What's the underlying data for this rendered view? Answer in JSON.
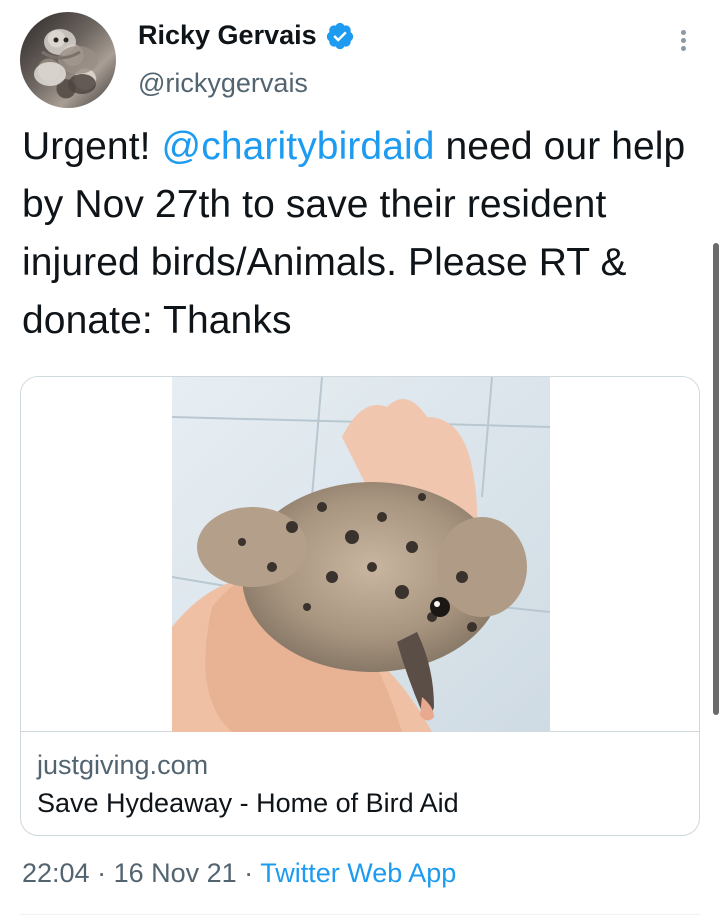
{
  "author": {
    "display_name": "Ricky Gervais",
    "handle": "@rickygervais",
    "verified": true,
    "avatar_icon": "avatar-photo-cats"
  },
  "tweet": {
    "text_before_mention": "Urgent! ",
    "mention": "@charitybirdaid",
    "text_after_mention": " need our help by Nov 27th to save their resident injured birds/Animals. Please RT & donate: Thanks"
  },
  "card": {
    "domain": "justgiving.com",
    "title": "Save Hydeaway - Home of Bird Aid",
    "image_icon": "bird-chick-photo"
  },
  "meta": {
    "time": "22:04",
    "separator": " · ",
    "date": "16 Nov 21",
    "source": "Twitter Web App"
  },
  "colors": {
    "accent": "#1d9bf0",
    "text": "#0f1419",
    "secondary": "#536471",
    "border": "#cfd9de"
  },
  "icons": {
    "verified": "verified-badge-icon",
    "more": "more-options-icon"
  }
}
